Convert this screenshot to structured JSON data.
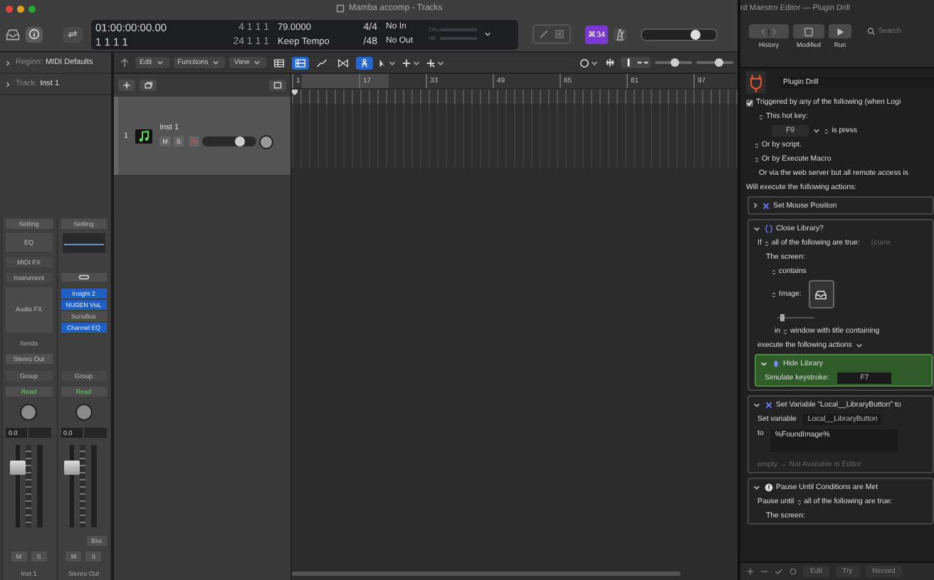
{
  "logic": {
    "title": "Mamba accomp - Tracks",
    "lcd": {
      "rows": [
        [
          "01:00:00:00.00",
          "4 1 1 1",
          "79.0000",
          "4/4",
          "No In"
        ],
        [
          "1 1 1 1",
          "24 1 1 1",
          "Keep Tempo",
          "/48",
          "No Out"
        ]
      ],
      "meters": [
        "CPU",
        "HD"
      ]
    },
    "key_badge": "⌘34",
    "master_volume": {
      "level": 0.72
    },
    "region": {
      "label": "Region:",
      "value": "MIDI Defaults"
    },
    "track_inspector": {
      "label": "Track:",
      "value": "Inst 1"
    },
    "menus": [
      "Edit",
      "Functions",
      "View"
    ],
    "view_buttons": [
      {
        "kind": "grid",
        "on": false
      },
      {
        "kind": "list",
        "on": true
      },
      {
        "kind": "automation",
        "on": false
      },
      {
        "kind": "flex",
        "on": false
      },
      {
        "kind": "catch",
        "on": true
      }
    ],
    "zoom_sliders": [
      {
        "level": 0.55
      },
      {
        "level": 0.6
      }
    ],
    "tracks": [
      {
        "number": "1",
        "name": "Inst 1",
        "mute": "M",
        "solo": "S",
        "record": "R",
        "volume": {
          "level": 0.72
        }
      }
    ],
    "ruler": [
      "1",
      "17",
      "33",
      "49",
      "65",
      "81",
      "97"
    ],
    "strips": [
      {
        "setting": "Setting",
        "eq": "EQ",
        "midi_fx": "MIDI FX",
        "instrument": "Instrument",
        "audio_fx": "Audio FX",
        "sends": "Sends",
        "output": "Stereo Out",
        "group": "Group",
        "automation": "Read",
        "pan": "0.0",
        "fader": {
          "level": 0.72
        },
        "mute": "M",
        "solo": "S",
        "name": "Inst 1"
      },
      {
        "setting": "Setting",
        "plugins": [
          {
            "name": "Insight 2",
            "active": true
          },
          {
            "name": "NUGEN VisL",
            "active": true
          },
          {
            "name": "SonoBus",
            "active": false
          },
          {
            "name": "Channel EQ",
            "active": true
          }
        ],
        "group": "Group",
        "automation": "Read",
        "pan": "0.0",
        "fader": {
          "level": 0.72
        },
        "bounce": "Bnc",
        "mute": "M",
        "solo": "S",
        "name": "Stereo Out"
      }
    ]
  },
  "km": {
    "title": "rd Maestro Editor — Plugin Drill",
    "toolbar": [
      {
        "kind": "history",
        "label": "History"
      },
      {
        "kind": "modified",
        "label": "Modified"
      },
      {
        "kind": "run",
        "label": "Run"
      }
    ],
    "search": {
      "placeholder": "Search"
    },
    "macro_name": "Plugin Drill",
    "trigger": {
      "checked": true,
      "text": "Triggered by any of the following (when Logi"
    },
    "hotkey": {
      "label": "This hot key:",
      "key": "F9",
      "condition": "is press"
    },
    "alternatives": [
      "Or by script.",
      "Or by Execute Macro"
    ],
    "web_note": "Or via the web server but all remote access is",
    "actions_heading": "Will execute the following actions:",
    "actions": [
      {
        "kind": "mouse",
        "title": "Set Mouse Position",
        "expanded": false
      },
      {
        "kind": "if",
        "title": "Close Library?",
        "expanded": true,
        "prefix": "If",
        "mode": "all of the following are true:",
        "note": "(curre",
        "screen": "The screen:",
        "test": "contains",
        "image_label": "Image:",
        "slider": {
          "level": 0.12
        },
        "window_prefix": "in",
        "window_text": "window with title containing",
        "then": "execute the following actions",
        "inner": {
          "title": "Hide Library",
          "expanded": true,
          "label": "Simulate keystroke:",
          "key": "F7"
        }
      },
      {
        "kind": "variable",
        "title": "Set Variable \"Local__LibraryButton\" to",
        "expanded": true,
        "label": "Set variable",
        "name": "Local__LibraryButton",
        "to_label": "to",
        "value": "%FoundImage%",
        "hint": "empty → Not Available in Editor"
      },
      {
        "kind": "pause",
        "title": "Pause Until Conditions are Met",
        "expanded": true,
        "label": "Pause until",
        "mode": "all of the following are true:",
        "screen": "The screen:"
      }
    ],
    "bottom": [
      "Edit",
      "Try",
      "Record"
    ]
  }
}
